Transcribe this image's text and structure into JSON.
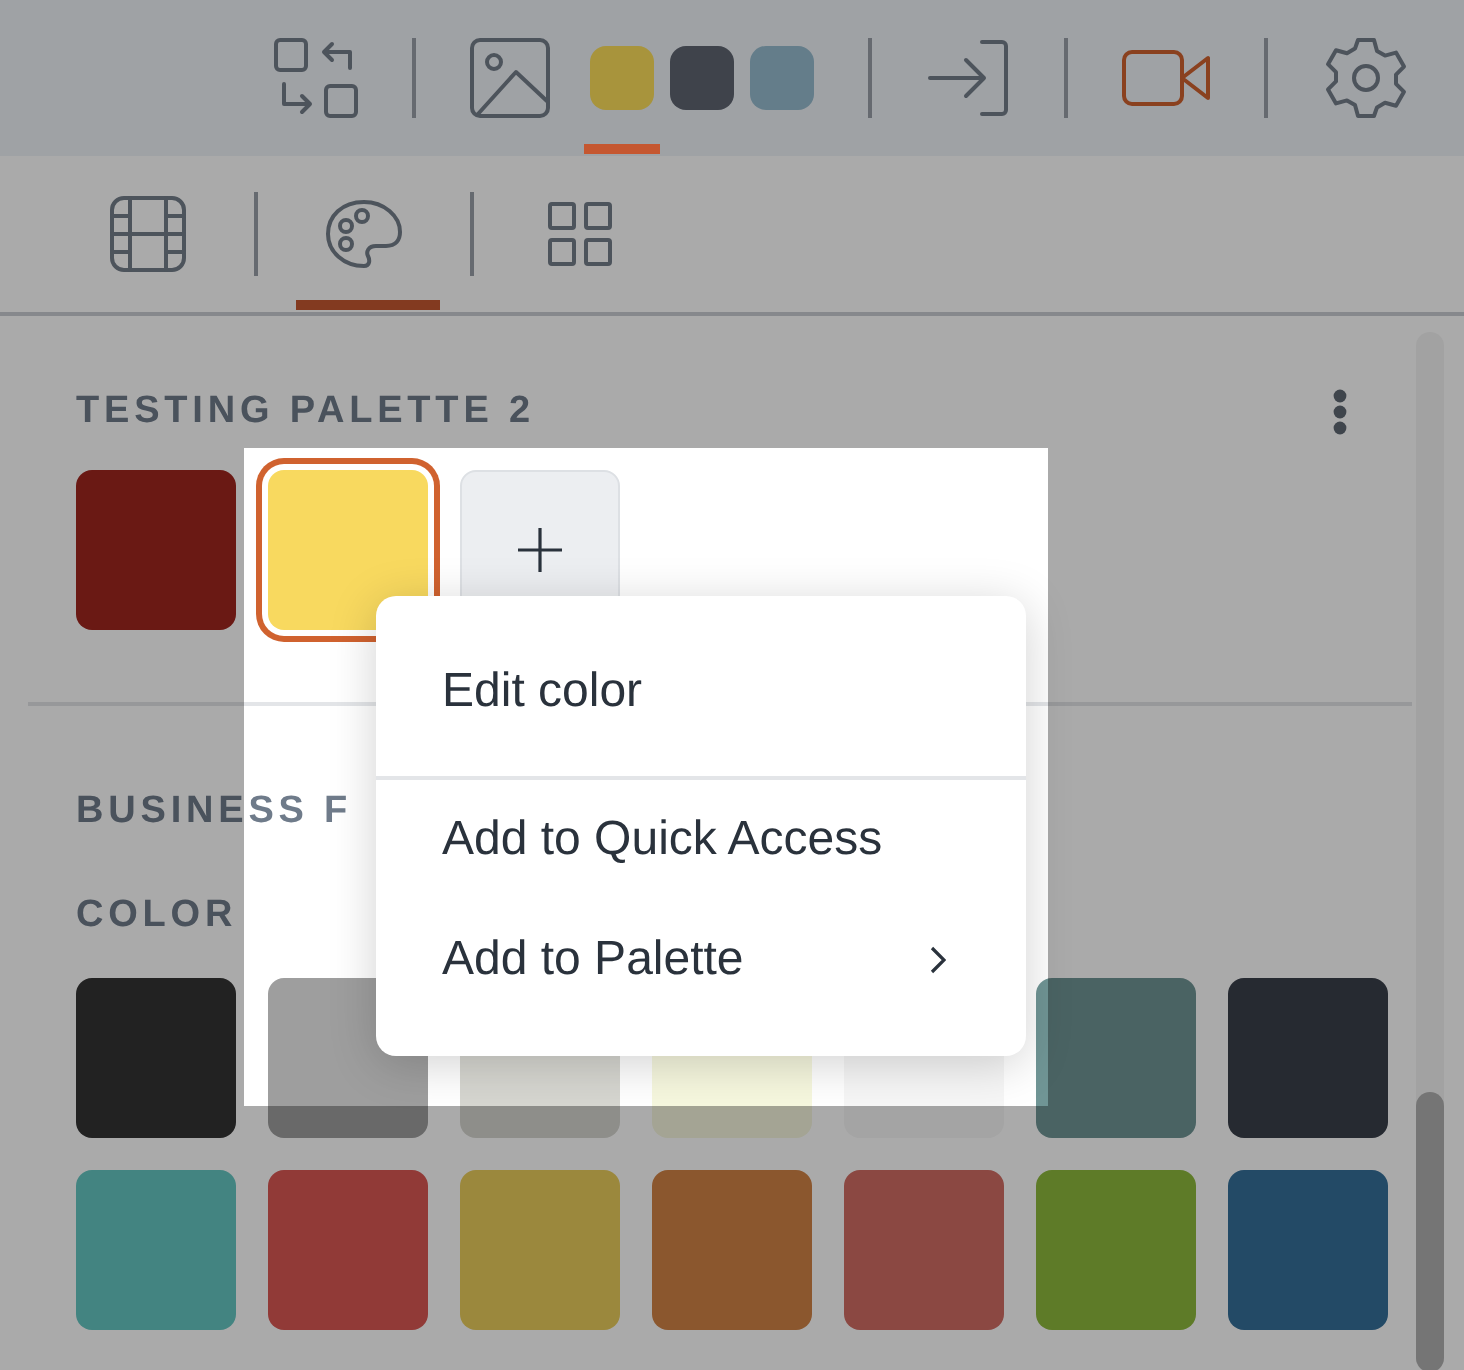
{
  "toolbar": {
    "tool_groups": [
      [
        {
          "kind": "swap"
        }
      ],
      [
        {
          "kind": "image"
        },
        {
          "kind": "swatches",
          "swatches": [
            {
              "color": "#a8943c",
              "selected": true
            },
            {
              "color": "#3f434b",
              "selected": false
            },
            {
              "color": "#647d8a",
              "selected": false
            }
          ]
        }
      ],
      [
        {
          "kind": "sign-in"
        }
      ],
      [
        {
          "kind": "video"
        }
      ],
      [
        {
          "kind": "settings"
        }
      ]
    ]
  },
  "tabs": [
    {
      "kind": "grid",
      "selected": false
    },
    {
      "kind": "palette",
      "selected": true
    },
    {
      "kind": "apps",
      "selected": false
    }
  ],
  "palettes": [
    {
      "title": "TESTING PALETTE 2",
      "menu": true,
      "add_button": true,
      "swatches": [
        {
          "color": "#6a1914",
          "selected": false
        },
        {
          "color": "#f8d95f",
          "selected": true
        }
      ]
    }
  ],
  "library": {
    "title": "BUSINESS F",
    "subtitle": "COLOR",
    "swatches": [
      {
        "color": "#222222"
      },
      {
        "color": "#9e9e9e"
      },
      {
        "color": "#d6d6d0"
      },
      {
        "color": "#f6f7de"
      },
      {
        "color": "#f6f6f6"
      },
      {
        "color": "#709595"
      },
      {
        "color": "#262a31"
      },
      {
        "color": "#438481"
      },
      {
        "color": "#913a37"
      },
      {
        "color": "#9b883d"
      },
      {
        "color": "#8b572e"
      },
      {
        "color": "#8b4842"
      },
      {
        "color": "#5e7b28"
      },
      {
        "color": "#234a66"
      }
    ]
  },
  "context_menu": {
    "groups": [
      [
        {
          "label": "Edit color",
          "submenu": false
        }
      ],
      [
        {
          "label": "Add to Quick Access",
          "submenu": false
        },
        {
          "label": "Add to Palette",
          "submenu": true
        }
      ]
    ]
  }
}
